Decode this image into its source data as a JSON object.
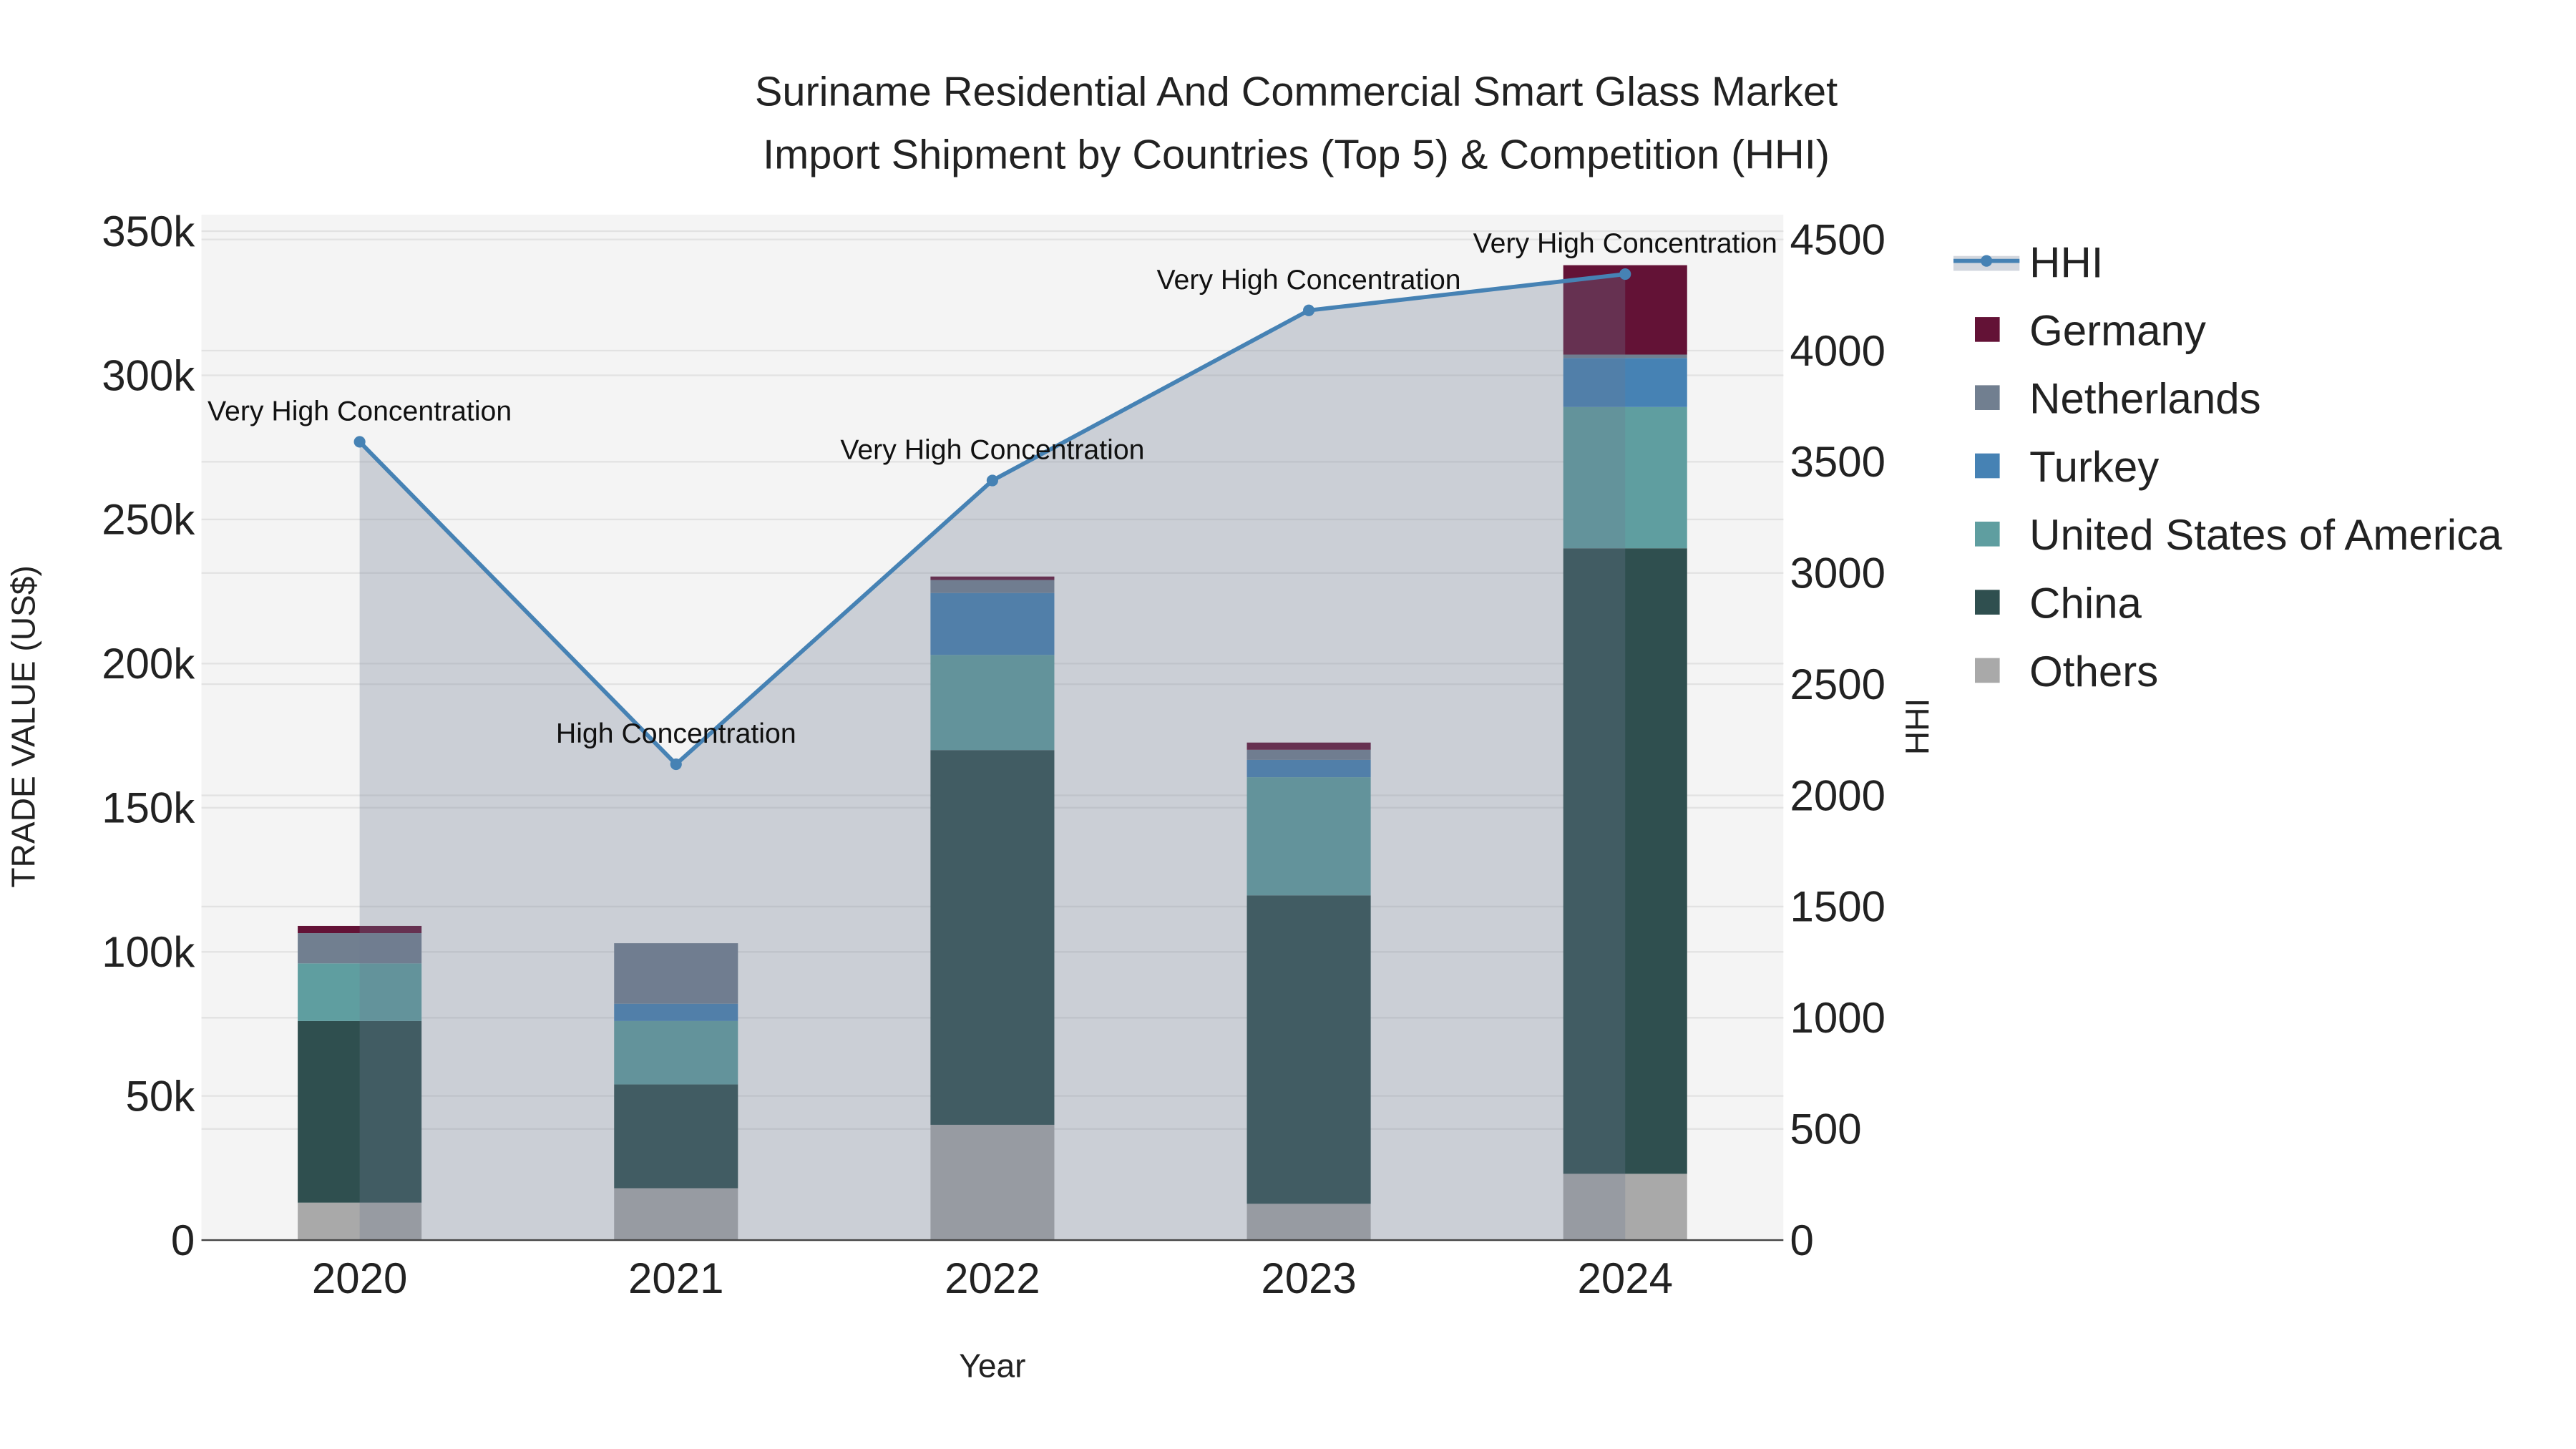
{
  "chart_data": {
    "type": "bar",
    "title_line1": "Suriname Residential And Commercial Smart Glass Market",
    "title_line2": "Import Shipment by Countries (Top 5) & Competition (HHI)",
    "xlabel": "Year",
    "ylabel": "TRADE VALUE (US$)",
    "y2label": "HHI",
    "categories": [
      "2020",
      "2021",
      "2022",
      "2023",
      "2024"
    ],
    "ylim": [
      0,
      350000
    ],
    "y_ticks": [
      0,
      50000,
      100000,
      150000,
      200000,
      250000,
      300000,
      350000
    ],
    "y_tick_labels": [
      "0",
      "50k",
      "100k",
      "150k",
      "200k",
      "250k",
      "300k",
      "350k"
    ],
    "y2lim": [
      0,
      4500
    ],
    "y2_ticks": [
      0,
      500,
      1000,
      1500,
      2000,
      2500,
      3000,
      3500,
      4000,
      4500
    ],
    "y2_tick_labels": [
      "0",
      "500",
      "1000",
      "1500",
      "2000",
      "2500",
      "3000",
      "3500",
      "4000",
      "4500"
    ],
    "grid": true,
    "legend_position": "right",
    "stack_order": [
      "Others",
      "China",
      "United States of America",
      "Turkey",
      "Netherlands",
      "Germany"
    ],
    "series": [
      {
        "name": "Germany",
        "color": "#631236",
        "values": [
          2500,
          0,
          1200,
          2500,
          31000
        ]
      },
      {
        "name": "Netherlands",
        "color": "#717f90",
        "values": [
          10500,
          21000,
          4500,
          3500,
          1200
        ]
      },
      {
        "name": "Turkey",
        "color": "#4682b4",
        "values": [
          0,
          6000,
          21500,
          6000,
          17000
        ]
      },
      {
        "name": "United States of America",
        "color": "#5f9ea0",
        "values": [
          20000,
          22000,
          33000,
          41000,
          49000
        ]
      },
      {
        "name": "China",
        "color": "#2f4f4f",
        "values": [
          63000,
          36000,
          130000,
          107000,
          217000
        ]
      },
      {
        "name": "Others",
        "color": "#a9a9a9",
        "values": [
          13000,
          18000,
          40000,
          12600,
          23000
        ]
      }
    ],
    "hhi": {
      "name": "HHI",
      "color": "#4682b4",
      "values": [
        3590,
        2140,
        3416,
        4181,
        4344
      ],
      "annotations": [
        "Very High Concentration",
        "High Concentration",
        "Very High Concentration",
        "Very High Concentration",
        "Very High Concentration"
      ]
    }
  }
}
